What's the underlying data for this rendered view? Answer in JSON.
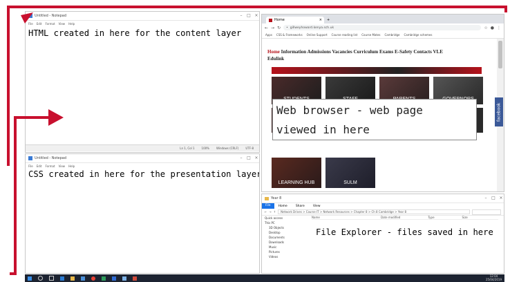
{
  "notepad_top": {
    "title": "Untitled - Notepad",
    "menu": [
      "File",
      "Edit",
      "Format",
      "View",
      "Help"
    ],
    "content": "HTML created in here for the content layer",
    "status": [
      "Ln 1, Col 1",
      "100%",
      "Windows (CRLF)",
      "UTF-8"
    ]
  },
  "notepad_bottom": {
    "title": "Untitled - Notepad",
    "menu": [
      "File",
      "Edit",
      "Format",
      "View",
      "Help"
    ],
    "content": "CSS created in here for the presentation layer"
  },
  "browser": {
    "tab_title": "Home",
    "url": "gillweyhoward.kenya.sch.uk",
    "bookmarks": [
      "Apps",
      "CSS & Frameworks",
      "Online Support",
      "Course reading list",
      "Course Mates",
      "Cambridge",
      "Cambridge schemes"
    ],
    "nav": [
      "Home",
      "Information",
      "Admissions",
      "Vacancies",
      "Curriculum",
      "Exams",
      "E-Safety",
      "Contacts",
      "VLE",
      "Edulink"
    ],
    "tiles": [
      "STUDENTS",
      "STAFF",
      "PARENTS",
      "GOVERNORS",
      "LEARNING HUB",
      "SULM"
    ],
    "annotation_line1": "Web browser - web page",
    "annotation_line2": "viewed in here",
    "facebook_tab": "facebook"
  },
  "explorer": {
    "title": "Year 8",
    "ribbon_tabs": [
      "File",
      "Home",
      "Share",
      "View"
    ],
    "path": "Network Drives > Course IT > Network Resources > Chapter 8 > Ch 8 Cambridge > Year 8",
    "sidebar": [
      "Quick access",
      "This PC",
      "3D Objects",
      "Desktop",
      "Documents",
      "Downloads",
      "Music",
      "Pictures",
      "Videos"
    ],
    "columns": [
      "Name",
      "Date modified",
      "Type",
      "Size"
    ],
    "annotation": "File Explorer - files saved in here"
  },
  "taskbar": {
    "time": "12:04",
    "date": "25/04/2019"
  },
  "colors": {
    "arrow_red": "#c8102e",
    "taskbar": "#1c2331",
    "browser_nav_red": "#b5121b"
  }
}
